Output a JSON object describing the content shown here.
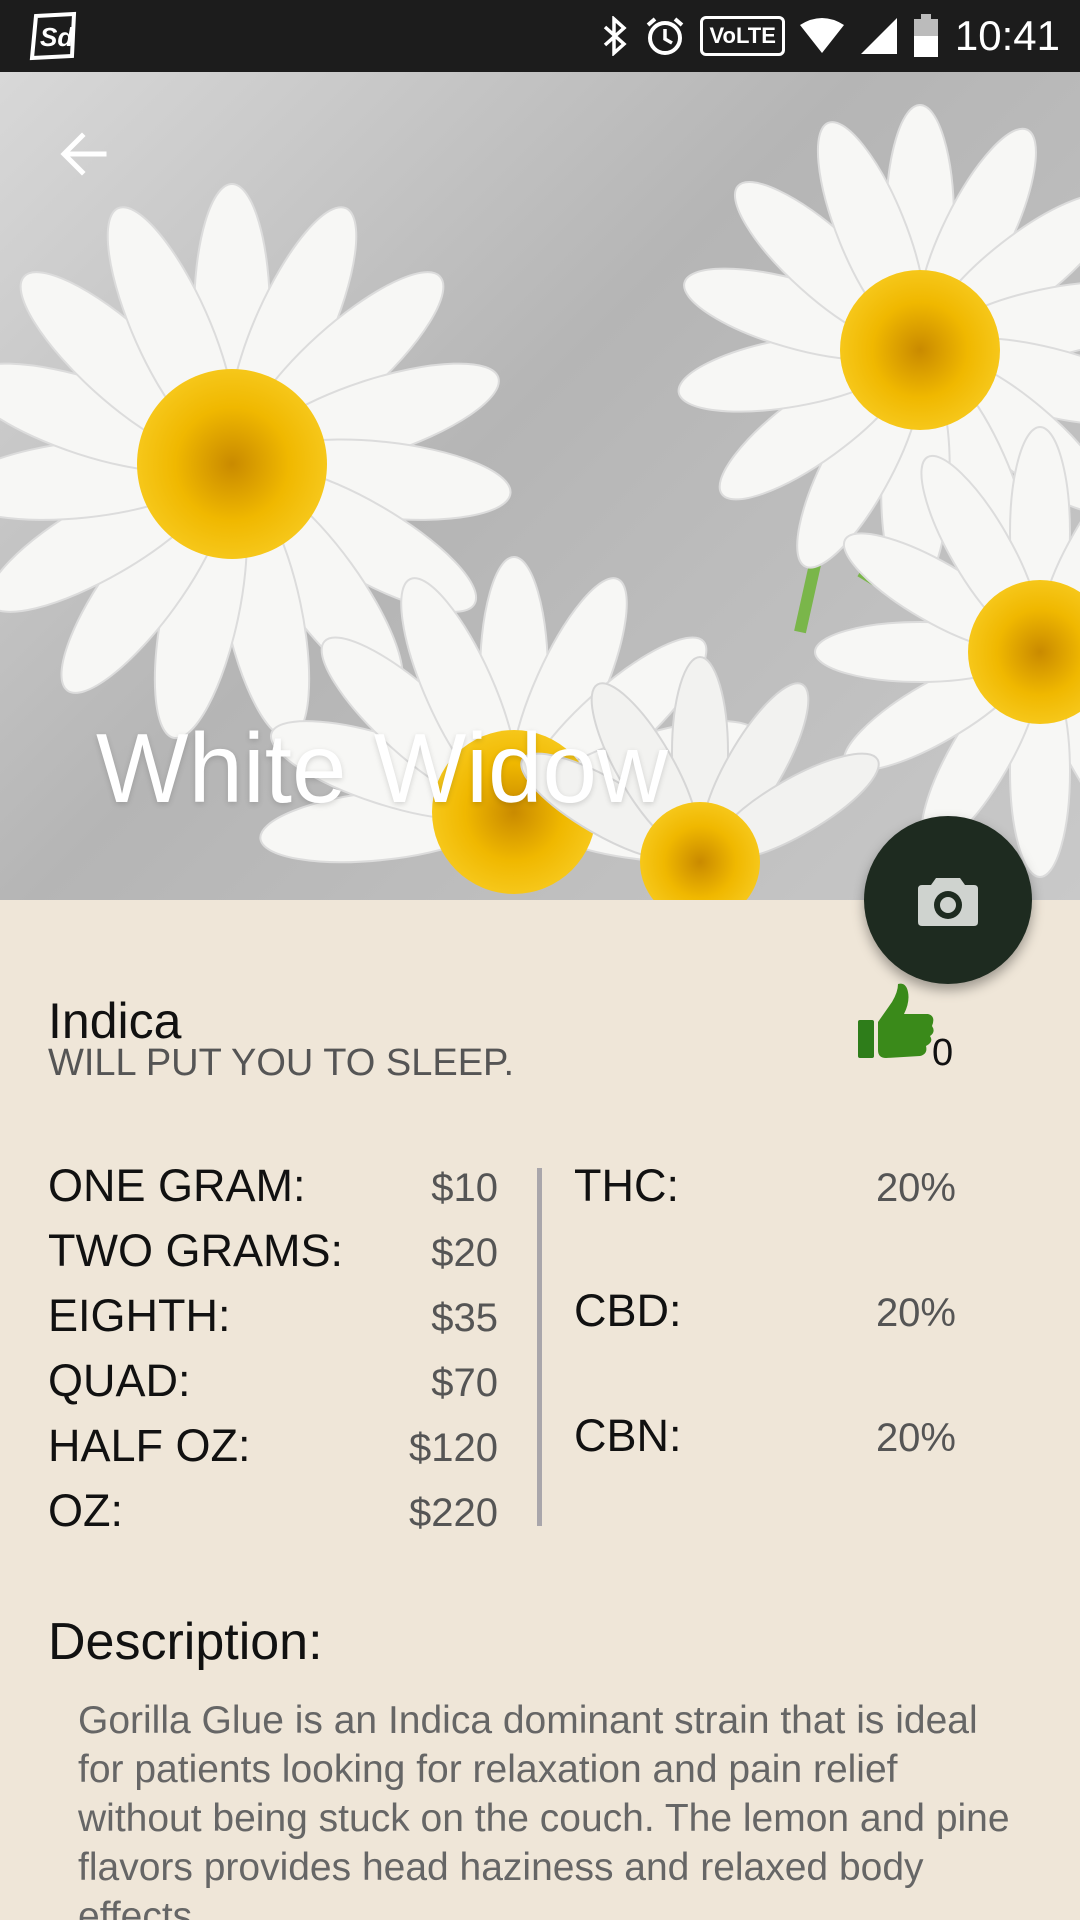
{
  "status_bar": {
    "time": "10:41",
    "volte_label": "VoLTE",
    "icons": [
      "app-logo-icon",
      "bluetooth-icon",
      "alarm-icon",
      "volte-icon",
      "wifi-icon",
      "signal-icon",
      "battery-icon"
    ]
  },
  "hero": {
    "title": "White Widow",
    "back_icon": "arrow-left-icon"
  },
  "fab": {
    "icon": "camera-icon"
  },
  "strain": {
    "type": "Indica",
    "tagline": "WILL PUT YOU TO SLEEP.",
    "likes": "0",
    "like_icon": "thumbs-up-icon"
  },
  "prices": [
    {
      "label": "ONE GRAM:",
      "value": "$10"
    },
    {
      "label": "TWO GRAMS:",
      "value": "$20"
    },
    {
      "label": "EIGHTH:",
      "value": "$35"
    },
    {
      "label": "QUAD:",
      "value": "$70"
    },
    {
      "label": "HALF OZ:",
      "value": "$120"
    },
    {
      "label": "OZ:",
      "value": "$220"
    }
  ],
  "cannabinoids": [
    {
      "label": "THC:",
      "value": "20%"
    },
    {
      "label": "CBD:",
      "value": "20%"
    },
    {
      "label": "CBN:",
      "value": "20%"
    }
  ],
  "description": {
    "title": "Description:",
    "body": "Gorilla Glue is an Indica dominant strain that is ideal for patients looking for relaxation and pain relief without being stuck on the couch. The lemon and pine flavors provides head haziness and relaxed body effects."
  },
  "colors": {
    "background": "#efe6d8",
    "fab": "#1e2b20",
    "like_green": "#3a8a1a",
    "status_bar": "#1c1c1c"
  }
}
